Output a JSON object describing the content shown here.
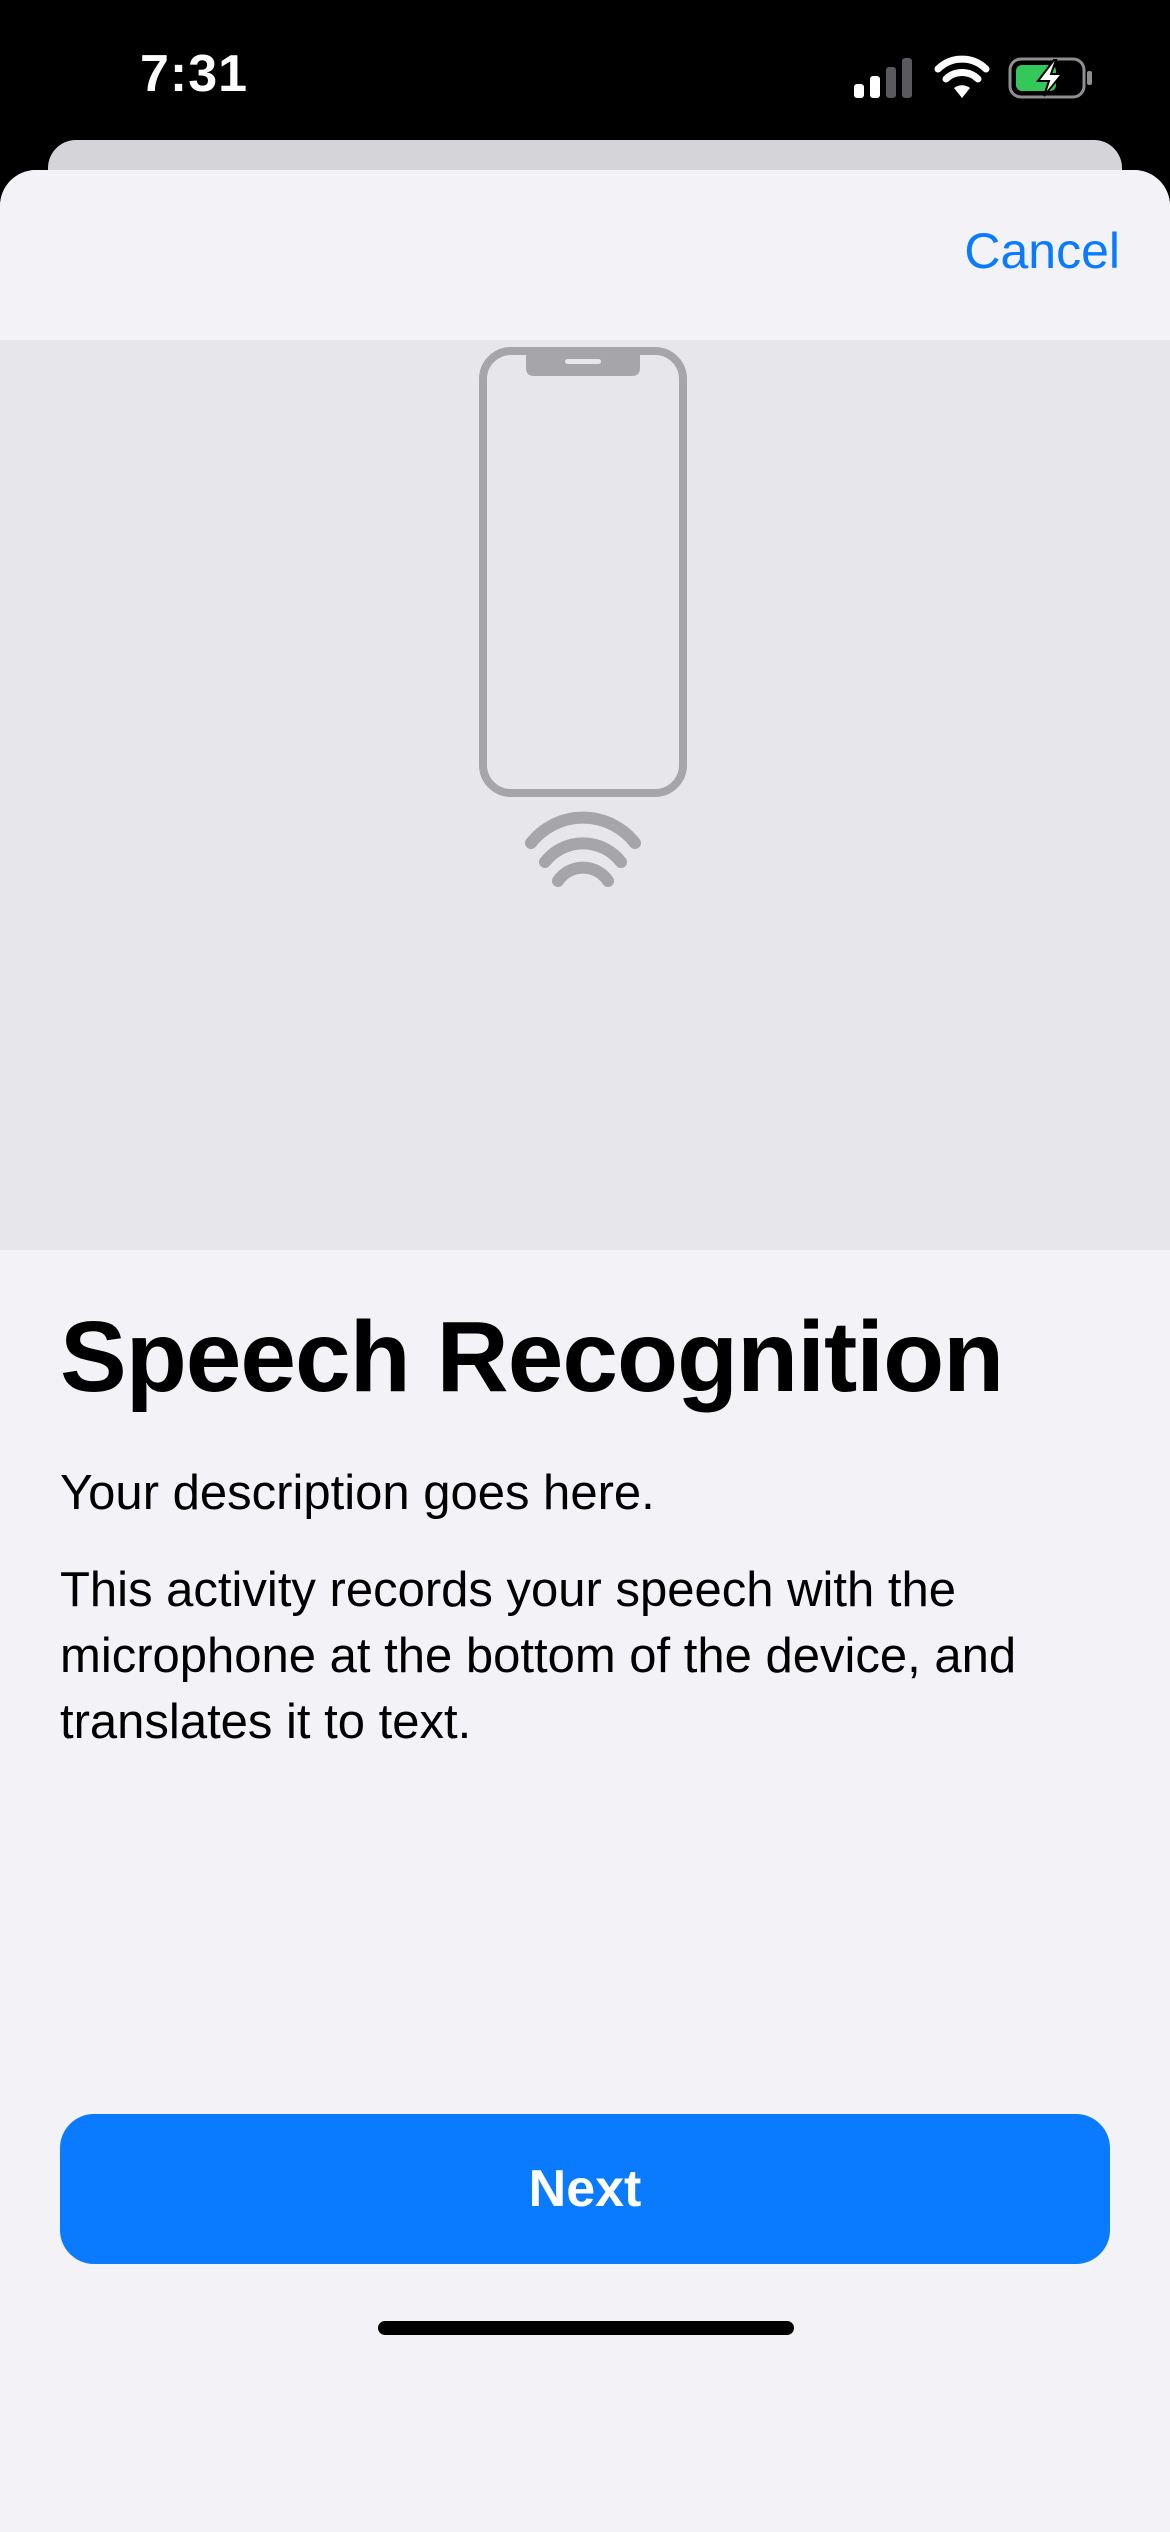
{
  "status_bar": {
    "time": "7:31",
    "icons": [
      "cellular-signal-icon",
      "wifi-icon",
      "battery-charging-icon"
    ]
  },
  "nav": {
    "cancel_label": "Cancel"
  },
  "hero": {
    "illustration": "phone-with-sound-waves-icon"
  },
  "content": {
    "title": "Speech Recognition",
    "description": "Your description goes here.",
    "detail": "This activity records your speech with the microphone at the bottom of the device, and translates it to text."
  },
  "footer": {
    "next_label": "Next"
  },
  "colors": {
    "accent": "#0A7AFF",
    "sheet_background": "#F2F2F7",
    "hero_background": "#E6E6EB",
    "icon_gray": "#A5A5AA"
  }
}
